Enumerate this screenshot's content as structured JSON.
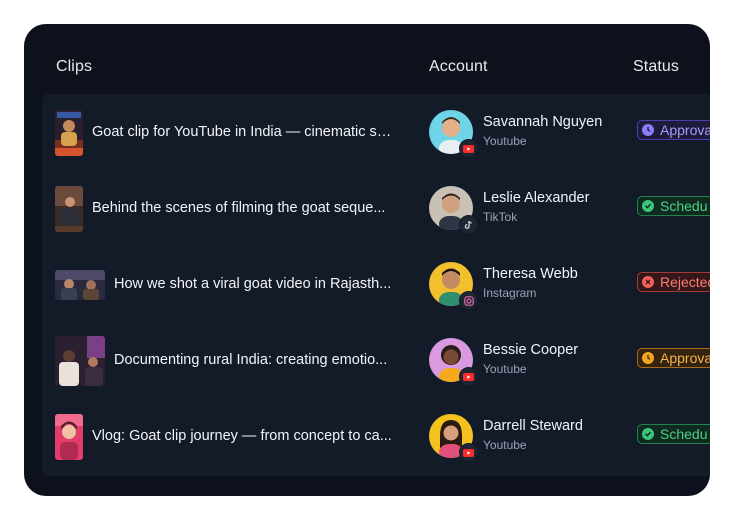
{
  "table": {
    "columns": [
      "Clips",
      "Account",
      "Status"
    ],
    "rows": [
      {
        "clip": "Goat clip for YouTube in India — cinematic st...",
        "account_name": "Savannah Nguyen",
        "platform": "Youtube",
        "platform_icon": "youtube-icon",
        "status": "Approva",
        "status_kind": "pending-approval"
      },
      {
        "clip": "Behind the scenes of filming the goat seque...",
        "account_name": "Leslie Alexander",
        "platform": "TikTok",
        "platform_icon": "tiktok-icon",
        "status": "Schedu",
        "status_kind": "scheduled"
      },
      {
        "clip": "How we shot a viral goat video in Rajasth...",
        "account_name": "Theresa Webb",
        "platform": "Instagram",
        "platform_icon": "instagram-icon",
        "status": "Rejected",
        "status_kind": "rejected"
      },
      {
        "clip": "Documenting rural India: creating emotio...",
        "account_name": "Bessie Cooper",
        "platform": "Youtube",
        "platform_icon": "youtube-icon",
        "status": "Approva",
        "status_kind": "awaiting-approval"
      },
      {
        "clip": "Vlog: Goat clip journey — from concept to ca...",
        "account_name": "Darrell Steward",
        "platform": "Youtube",
        "platform_icon": "youtube-icon",
        "status": "Schedu",
        "status_kind": "scheduled"
      }
    ]
  },
  "colors": {
    "card_bg": "#0c111c",
    "table_bg": "#131b29",
    "status_purple": "#8c7cf7",
    "status_green": "#3cc47a",
    "status_red": "#f1605a",
    "status_orange": "#f5a524"
  }
}
